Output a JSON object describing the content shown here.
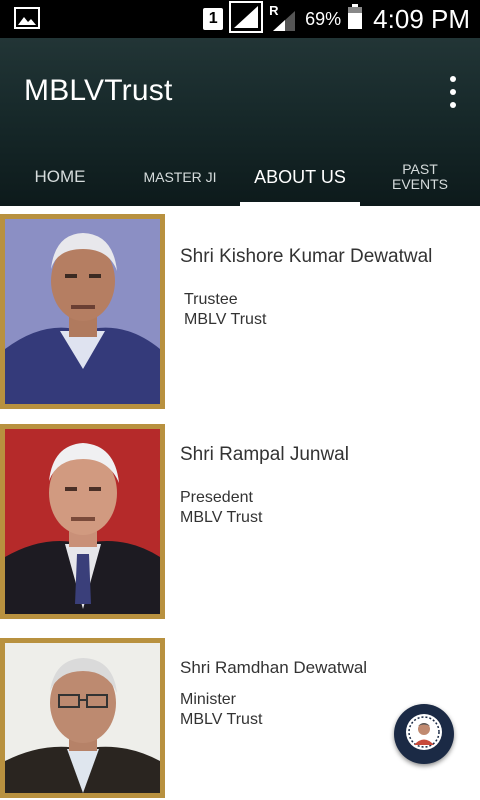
{
  "status_bar": {
    "sim_slot": "1",
    "roaming": "R",
    "battery_percent": "69%",
    "time": "4:09 PM"
  },
  "app": {
    "title": "MBLVTrust"
  },
  "tabs": [
    {
      "label": "HOME"
    },
    {
      "label": "MASTER JI"
    },
    {
      "label": "ABOUT US"
    },
    {
      "label": "PAST EVENTS"
    }
  ],
  "members": [
    {
      "name": "Shri Kishore Kumar Dewatwal",
      "role": "Trustee",
      "org": "MBLV Trust"
    },
    {
      "name": "Shri Rampal Junwal",
      "role": "Presedent",
      "org": "MBLV Trust"
    },
    {
      "name": "Shri Ramdhan Dewatwal",
      "role": "Minister",
      "org": "MBLV Trust"
    }
  ],
  "fab": {
    "icon": "guru-avatar-icon"
  },
  "colors": {
    "app_bar": "#1a2d2e",
    "tab_indicator": "#ffffff",
    "photo_frame": "#b8913f",
    "fab": "#1b2a45"
  }
}
